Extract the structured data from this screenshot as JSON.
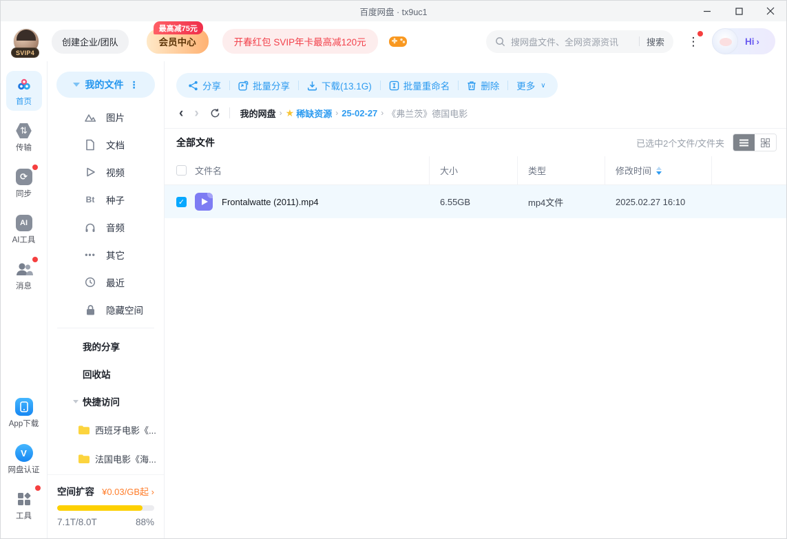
{
  "window": {
    "title": "百度网盘 · tx9uc1"
  },
  "header": {
    "svip_badge": "SVIP4",
    "create_team": "创建企业/团队",
    "vip_center": "会员中心",
    "vip_center_badge": "最高减75元",
    "promo": "开春红包 SVIP年卡最高减120元",
    "search_placeholder": "搜网盘文件、全网资源资讯",
    "search_button": "搜索",
    "hi": "Hi"
  },
  "rail": {
    "items": [
      {
        "label": "首页"
      },
      {
        "label": "传输"
      },
      {
        "label": "同步"
      },
      {
        "label": "AI工具"
      },
      {
        "label": "消息"
      }
    ],
    "bottom": [
      {
        "label": "App下载"
      },
      {
        "label": "网盘认证"
      },
      {
        "label": "工具"
      }
    ]
  },
  "sidebar": {
    "my_files": "我的文件",
    "bt_icon_text": "Bt",
    "other_icon_text": "•••",
    "categories": [
      "图片",
      "文档",
      "视频",
      "种子",
      "音频",
      "其它",
      "最近",
      "隐藏空间"
    ],
    "my_share": "我的分享",
    "recycle_bin": "回收站",
    "quick_access": "快捷访问",
    "folders": [
      "西班牙电影《...",
      "法国电影《海..."
    ],
    "storage": {
      "title": "空间扩容",
      "price": "¥0.03/GB起",
      "price_chevron": "›",
      "usage": "7.1T/8.0T",
      "percent": "88%",
      "percent_value": "88"
    }
  },
  "toolbar": {
    "share": "分享",
    "batch_share": "批量分享",
    "download": "下载(13.1G)",
    "batch_rename": "批量重命名",
    "delete": "删除",
    "more": "更多"
  },
  "breadcrumb": [
    "我的网盘",
    "稀缺资源",
    "25-02-27",
    "《弗兰茨》德国电影"
  ],
  "filelist": {
    "section_title": "全部文件",
    "selection_status": "已选中2个文件/文件夹",
    "columns": [
      "文件名",
      "大小",
      "类型",
      "修改时间"
    ],
    "rows": [
      {
        "name": "Frontalwatte (2011).mp4",
        "size": "6.55GB",
        "type": "mp4文件",
        "modified": "2025.02.27 16:10"
      }
    ]
  },
  "colors": {
    "accent_blue": "#2d9bf0",
    "checkbox_blue": "#07a8ff",
    "selected_row": "#f1f9fe",
    "progress_yellow": "#fdd000",
    "price_orange": "#ff7d2a",
    "notification_red": "#f53f3f",
    "video_icon_purple": "#7e7cf3",
    "folder_yellow": "#fcd43e"
  }
}
